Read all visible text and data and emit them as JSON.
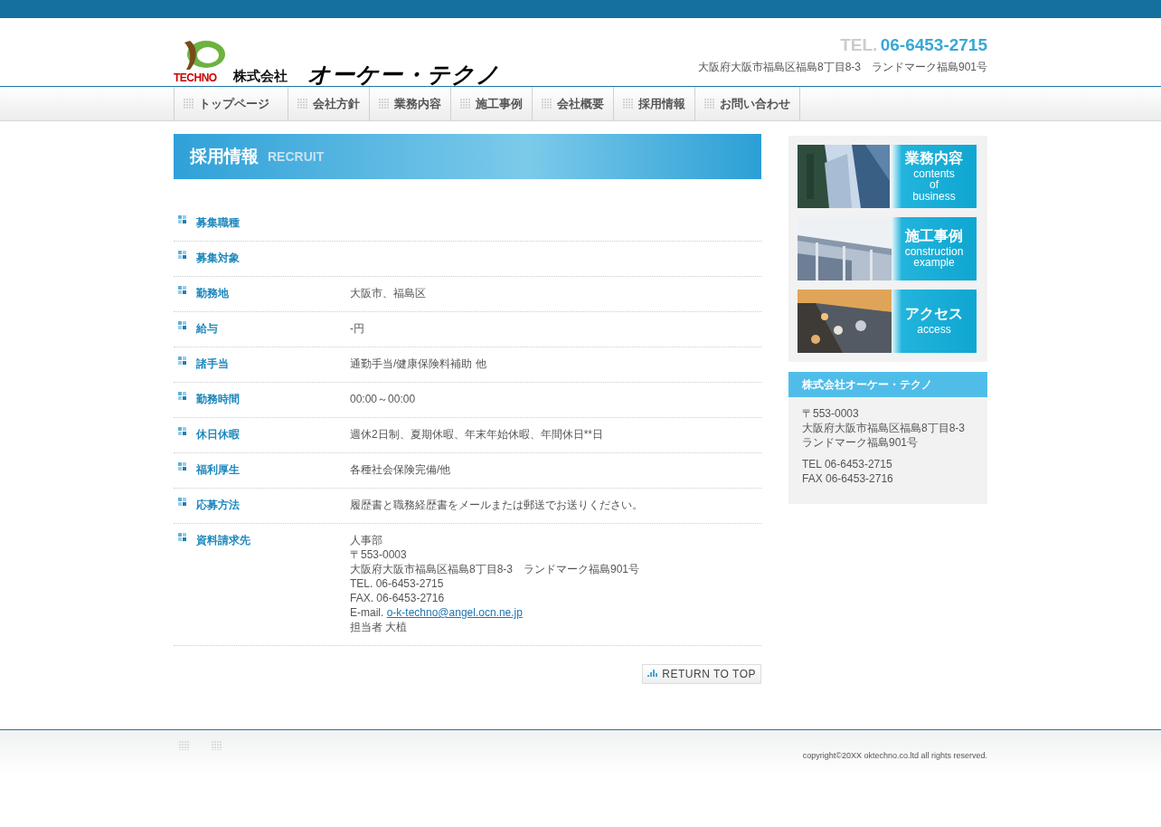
{
  "header": {
    "logo_mark": "TECHNO",
    "logo_company_type": "株式会社",
    "logo_name": "オーケー・テクノ",
    "tel_label": "TEL.",
    "tel_number": "06-6453-2715",
    "address": "大阪府大阪市福島区福島8丁目8-3　ランドマーク福島901号"
  },
  "nav": [
    {
      "label": "トップページ",
      "selected": false
    },
    {
      "label": "会社方針",
      "selected": false
    },
    {
      "label": "業務内容",
      "selected": false
    },
    {
      "label": "施工事例",
      "selected": false
    },
    {
      "label": "会社概要",
      "selected": false
    },
    {
      "label": "採用情報",
      "selected": false
    },
    {
      "label": "お問い合わせ",
      "selected": false
    }
  ],
  "page_title": {
    "title": "採用情報",
    "subtitle": "RECRUIT"
  },
  "recruit_table": [
    {
      "label": "募集職種"
    },
    {
      "label": "募集対象"
    },
    {
      "label": "勤務地",
      "lines": [
        {
          "text": "大阪市、福島区"
        }
      ]
    },
    {
      "label": "給与",
      "lines": [
        {
          "text": "-円"
        }
      ]
    },
    {
      "label": "諸手当",
      "lines": [
        {
          "text": "通勤手当/健康保険料補助 他"
        }
      ]
    },
    {
      "label": "勤務時間",
      "lines": [
        {
          "text": "00:00～00:00"
        }
      ]
    },
    {
      "label": "休日休暇",
      "lines": [
        {
          "text": "週休2日制、夏期休暇、年末年始休暇、年間休日**日"
        }
      ]
    },
    {
      "label": "福利厚生",
      "lines": [
        {
          "text": "各種社会保険完備/他"
        }
      ]
    },
    {
      "label": "応募方法",
      "lines": [
        {
          "text": "履歴書と職務経歴書をメールまたは郵送でお送りください。"
        }
      ]
    },
    {
      "label": "資料請求先",
      "lines": [
        {
          "text": "人事部"
        },
        {
          "text": "〒553-0003"
        },
        {
          "text": "大阪府大阪市福島区福島8丁目8-3　ランドマーク福島901号"
        },
        {
          "text": "TEL. 06-6453-2715"
        },
        {
          "text": "FAX. 06-6453-2716"
        },
        {
          "text": "E-mail.",
          "link": "o-k-techno@angel.ocn.ne.jp"
        },
        {
          "text": "担当者 大植"
        }
      ]
    }
  ],
  "return_to_top": "RETURN TO TOP",
  "side_banners": [
    {
      "kind": "city",
      "title": "業務内容",
      "subtitle_lines": [
        "contents",
        "of",
        "business"
      ]
    },
    {
      "kind": "facade",
      "title": "施工事例",
      "subtitle_lines": [
        "construction",
        "example"
      ]
    },
    {
      "kind": "road",
      "title": "アクセス",
      "subtitle_lines": [
        "access"
      ]
    }
  ],
  "company_box": {
    "title": "株式会社オーケー・テクノ",
    "address_lines": [
      "〒553-0003",
      "大阪府大阪市福島区福島8丁目8-3　ランドマーク福島901号"
    ],
    "contact_lines": [
      "TEL 06-6453-2715",
      "FAX 06-6453-2716"
    ]
  },
  "footer": {
    "copyright": "copyright©20XX oktechno.co.ltd all rights reserved."
  }
}
